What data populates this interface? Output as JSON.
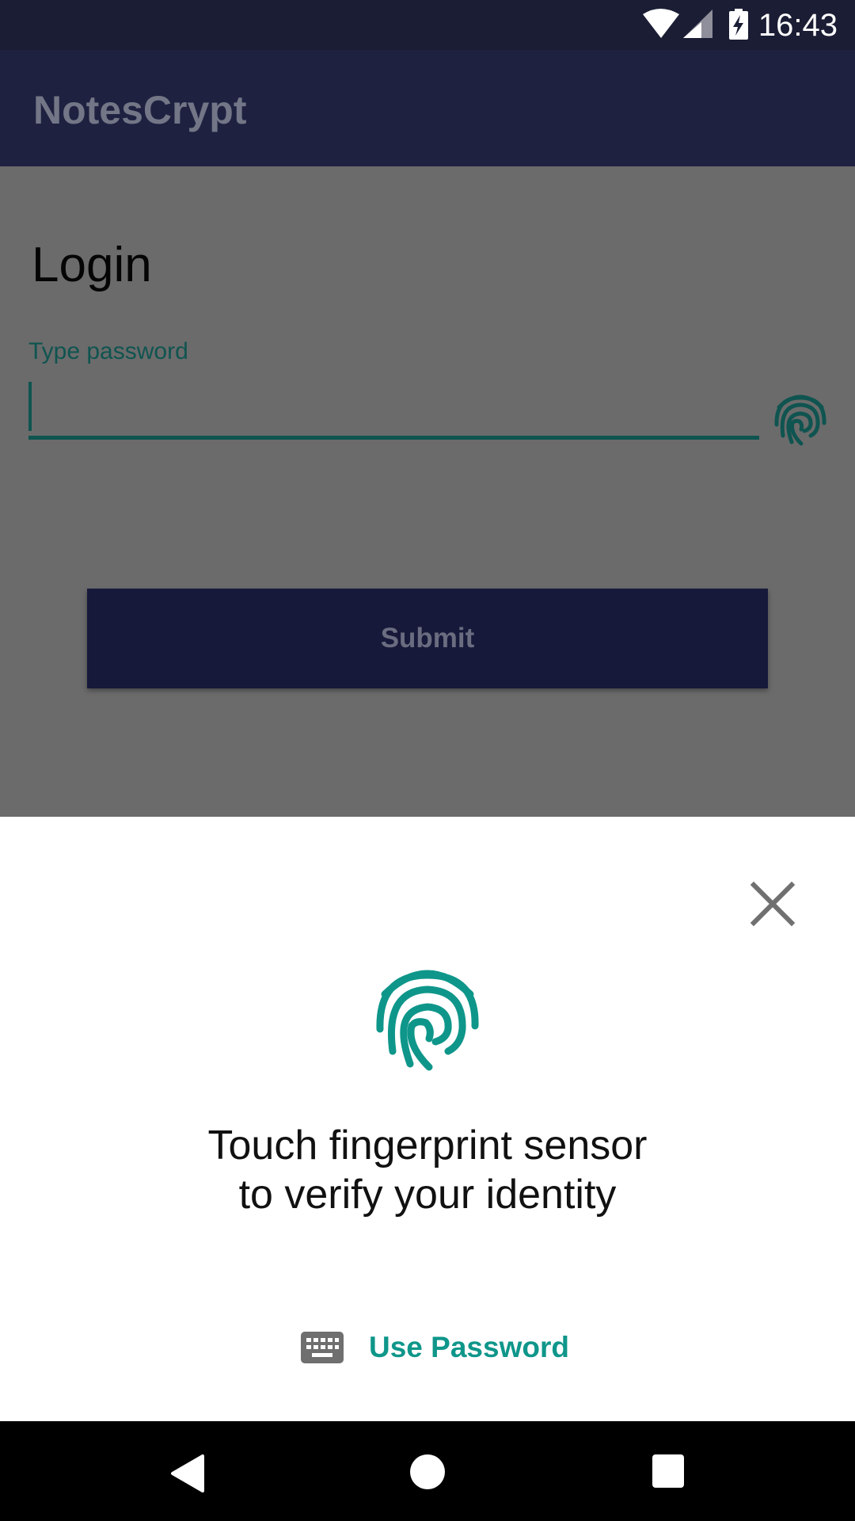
{
  "status_bar": {
    "time": "16:43",
    "icons": [
      "wifi-icon",
      "cell-signal-icon",
      "battery-charging-icon"
    ]
  },
  "app_bar": {
    "title": "NotesCrypt"
  },
  "login": {
    "title": "Login",
    "password_label": "Type password",
    "password_value": "",
    "submit_label": "Submit"
  },
  "fingerprint_sheet": {
    "message_line1": "Touch fingerprint sensor",
    "message_line2": "to verify your identity",
    "use_password_label": "Use Password",
    "accent_color": "#0f968a"
  },
  "nav_bar": {
    "buttons": [
      "back",
      "home",
      "recents"
    ]
  },
  "colors": {
    "status_bar": "#1b1d35",
    "app_bar": "#1e2140",
    "scrim": "#6b6b6b",
    "submit_button": "#17193a",
    "input_accent": "#0f5450",
    "sheet_background": "#ffffff",
    "nav_bar": "#000000"
  }
}
